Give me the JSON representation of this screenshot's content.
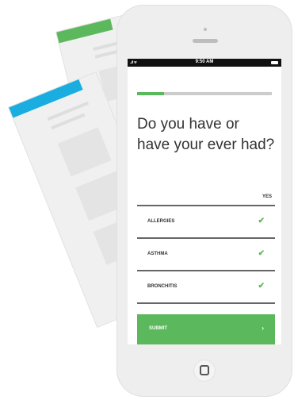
{
  "status_bar": {
    "signal": "..ıl ᯤ",
    "time": "9:50 AM"
  },
  "progress": {
    "fraction": 0.2,
    "fill_color": "#5cb85c",
    "track_color": "#cccccc"
  },
  "question": "Do you have or have your ever had?",
  "table": {
    "column_header": "YES",
    "rows": [
      {
        "label": "ALLERGIES",
        "check": "✔"
      },
      {
        "label": "ASTHMA",
        "check": "✔"
      },
      {
        "label": "BRONCHITIS",
        "check": "✔"
      }
    ]
  },
  "submit": {
    "label": "SUBMIT",
    "arrow": "›"
  },
  "colors": {
    "accent": "#5cb85c",
    "paper_strip_back": "#5cb85c",
    "paper_strip_front": "#1aaee0"
  },
  "icons": {
    "check": "check-icon",
    "arrow": "chevron-right-icon",
    "home": "home-button-icon",
    "battery": "battery-icon",
    "signal": "signal-icon"
  }
}
